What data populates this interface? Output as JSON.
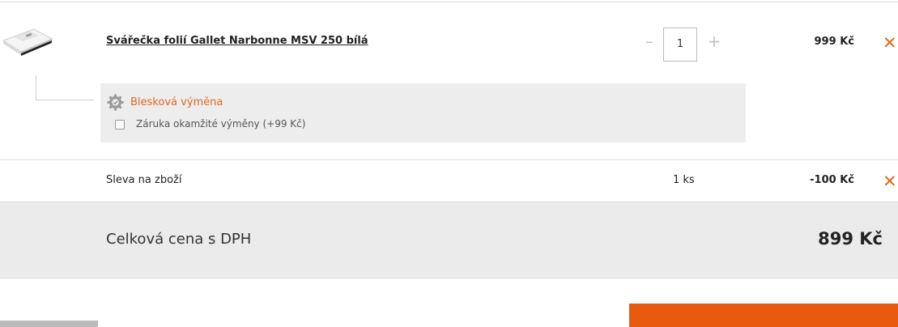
{
  "cart_item": {
    "image_alt": "Svářečka fólií Gallet Narbonne MSV 250 bílá",
    "name": "Svářečka folií Gallet Narbonne MSV 250 bílá",
    "quantity": "1",
    "qty_minus": "–",
    "qty_plus": "+",
    "price": "999 Kč",
    "remove": "✕"
  },
  "service": {
    "icon": "gear-badge-icon",
    "title": "Blesková výměna",
    "checkbox_label": "Záruka okamžité výměny (+99 Kč)",
    "checked": false
  },
  "discount": {
    "label": "Sleva na zboží",
    "quantity": "1 ks",
    "amount": "-100 Kč",
    "remove": "✕"
  },
  "total": {
    "label": "Celková cena s DPH",
    "value": "899 Kč"
  },
  "colors": {
    "accent": "#e0691e",
    "button_primary": "#e85b0f",
    "service_bg": "#ededed",
    "total_bg": "#ebebeb"
  }
}
